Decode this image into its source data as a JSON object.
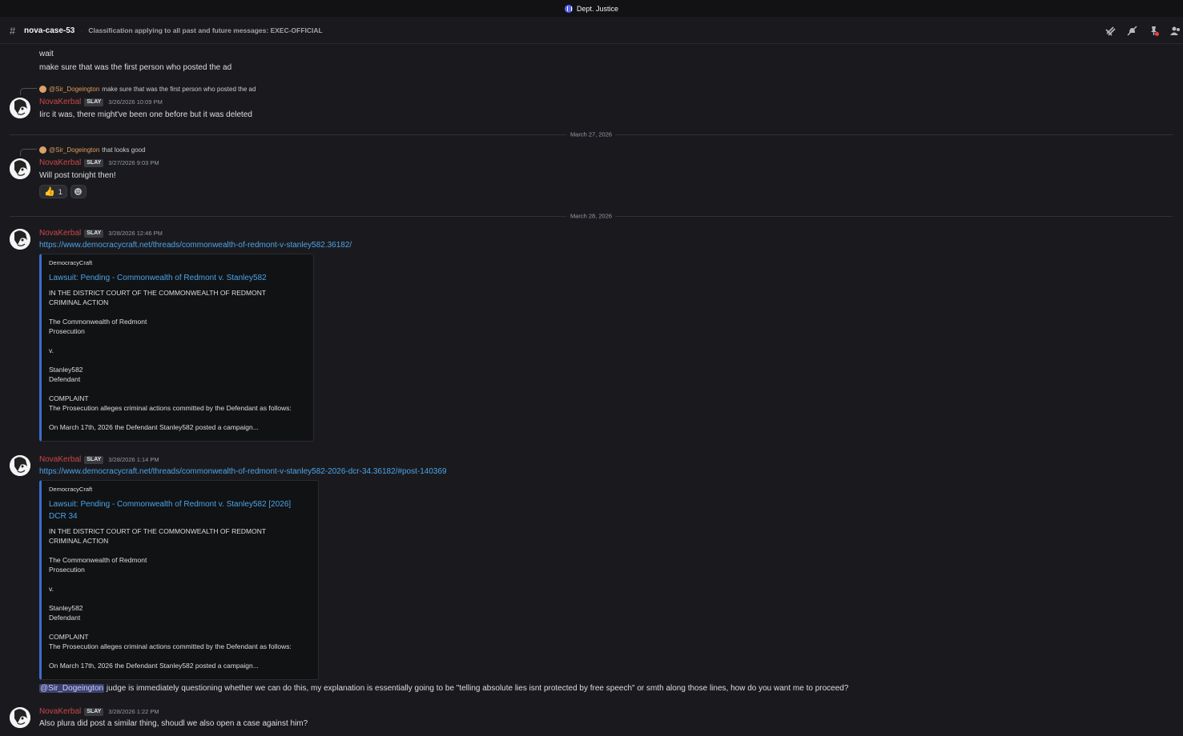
{
  "window": {
    "server_name": "Dept. Justice"
  },
  "channel": {
    "name": "nova-case-53",
    "topic": "Classification applying to all past and future messages: EXEC-OFFICIAL"
  },
  "toolbar": {
    "icons": [
      "threads-icon",
      "notifications-muted-icon",
      "pinned-icon",
      "members-icon"
    ]
  },
  "messages": {
    "m0": {
      "line1": "wait",
      "line2": "make sure that was the first person who posted the ad"
    },
    "m1": {
      "reply_to": "@Sir_Dogeington",
      "reply_text": "make sure that was the first person who posted the ad",
      "author": "NovaKerbal",
      "tag": "SLAY",
      "timestamp": "3/26/2026 10:09 PM",
      "text": "Iirc it was, there might've been one before but it was deleted"
    },
    "d1": "March 27, 2026",
    "m2": {
      "reply_to": "@Sir_Dogeington",
      "reply_text": "that looks good",
      "author": "NovaKerbal",
      "tag": "SLAY",
      "timestamp": "3/27/2026 9:03 PM",
      "text": "Will post tonight then!",
      "reaction_count": "1"
    },
    "d2": "March 28, 2026",
    "m3": {
      "author": "NovaKerbal",
      "tag": "SLAY",
      "timestamp": "3/28/2026 12:46 PM",
      "link": "https://www.democracycraft.net/threads/commonwealth-of-redmont-v-stanley582.36182/",
      "embed": {
        "provider": "DemocracyCraft",
        "title": "Lawsuit: Pending - Commonwealth of Redmont v. Stanley582",
        "body": "IN THE DISTRICT COURT OF THE COMMONWEALTH OF REDMONT\nCRIMINAL ACTION\n\nThe Commonwealth of Redmont\nProsecution\n\nv.\n\nStanley582\nDefendant\n\nCOMPLAINT\nThe Prosecution alleges criminal actions committed by the Defendant as follows:\n\nOn March 17th, 2026 the Defendant Stanley582 posted a campaign..."
      }
    },
    "m4": {
      "author": "NovaKerbal",
      "tag": "SLAY",
      "timestamp": "3/28/2026 1:14 PM",
      "link": "https://www.democracycraft.net/threads/commonwealth-of-redmont-v-stanley582-2026-dcr-34.36182/#post-140369",
      "embed": {
        "provider": "DemocracyCraft",
        "title_line1": "Lawsuit: Pending - Commonwealth of Redmont v. Stanley582 [2026]",
        "title_line2": "DCR 34",
        "body": "IN THE DISTRICT COURT OF THE COMMONWEALTH OF REDMONT\nCRIMINAL ACTION\n\nThe Commonwealth of Redmont\nProsecution\n\nv.\n\nStanley582\nDefendant\n\nCOMPLAINT\nThe Prosecution alleges criminal actions committed by the Defendant as follows:\n\nOn March 17th, 2026 the Defendant Stanley582 posted a campaign..."
      },
      "mention": "@Sir_Dogeington",
      "followup": " judge is immediately questioning whether we can do this, my explanation is essentially going to be \"telling absolute lies isnt protected by free speech\" or smth along those lines, how do you want me to proceed?"
    },
    "m5": {
      "author": "NovaKerbal",
      "tag": "SLAY",
      "timestamp": "3/28/2026 1:22 PM",
      "text": "Also plura did post a similar thing, shoudl we also open a case against him?"
    }
  }
}
